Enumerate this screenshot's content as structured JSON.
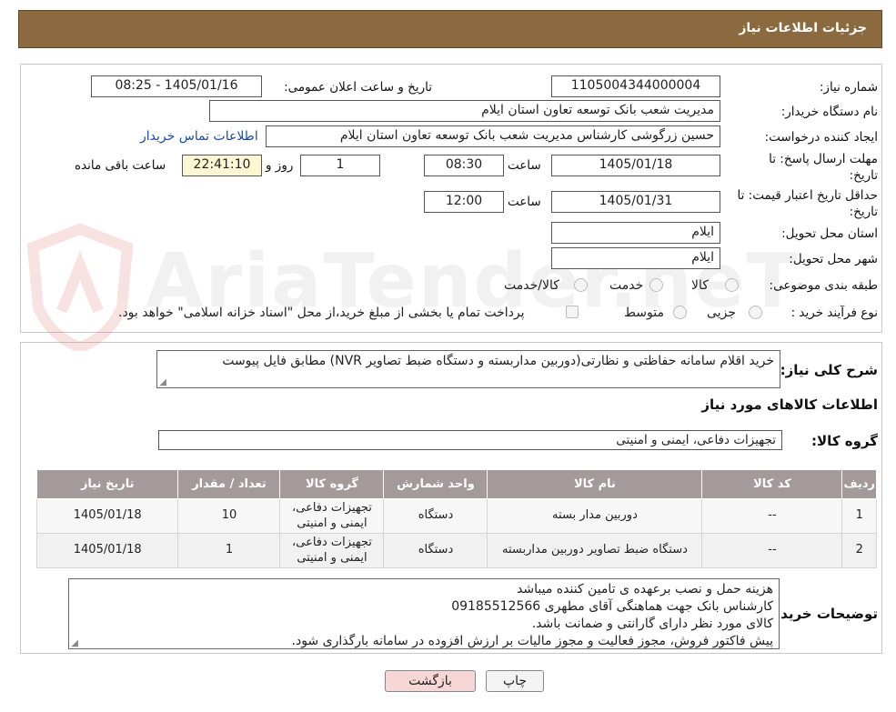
{
  "header": {
    "title": "جزئیات اطلاعات نیاز"
  },
  "watermark": {
    "text": "AriaTender.neT"
  },
  "form": {
    "need_number_label": "شماره نیاز:",
    "need_number": "1105004344000004",
    "announce_label": "تاریخ و ساعت اعلان عمومی:",
    "announce_value": "1405/01/16 - 08:25",
    "buyer_label": "نام دستگاه خریدار:",
    "buyer_value": "مدیریت شعب بانک توسعه تعاون استان ایلام",
    "creator_label": "ایجاد کننده درخواست:",
    "creator_value": "حسین زرگوشی کارشناس مدیریت شعب بانک توسعه تعاون استان ایلام",
    "contact_link": "اطلاعات تماس خریدار",
    "reply_deadline_label": "مهلت ارسال پاسخ: تا تاریخ:",
    "reply_date": "1405/01/18",
    "time_label": "ساعت",
    "reply_time": "08:30",
    "days_value": "1",
    "days_label": "روز و",
    "remaining_time": "22:41:10",
    "remaining_label": "ساعت باقی مانده",
    "validity_label": "حداقل تاریخ اعتبار قیمت: تا تاریخ:",
    "validity_date": "1405/01/31",
    "validity_time": "12:00",
    "province_label": "استان محل تحویل:",
    "province_value": "ایلام",
    "city_label": "شهر محل تحویل:",
    "city_value": "ایلام",
    "category_label": "طبقه بندی موضوعی:",
    "category_options": [
      "کالا",
      "خدمت",
      "کالا/خدمت"
    ],
    "process_label": "نوع فرآیند خرید :",
    "process_options": [
      "جزیی",
      "متوسط"
    ],
    "payment_note": "پرداخت تمام یا بخشی از مبلغ خرید،از محل \"اسناد خزانه اسلامی\" خواهد بود."
  },
  "details": {
    "summary_label": "شرح کلی نیاز:",
    "summary_value": "خرید اقلام سامانه حفاظتی و نظارتی(دوربین مداربسته و دستگاه ضبط تصاویر NVR) مطابق فایل پیوست",
    "goods_info_title": "اطلاعات کالاهای مورد نیاز",
    "goods_group_label": "گروه کالا:",
    "goods_group_value": "تجهیزات دفاعی، ایمنی و امنیتی",
    "table": {
      "headers": [
        "ردیف",
        "کد کالا",
        "نام کالا",
        "واحد شمارش",
        "گروه کالا",
        "تعداد / مقدار",
        "تاریخ نیاز"
      ],
      "rows": [
        [
          "1",
          "--",
          "دوربین مدار بسته",
          "دستگاه",
          "تجهیزات دفاعی، ایمنی و امنیتی",
          "10",
          "1405/01/18"
        ],
        [
          "2",
          "--",
          "دستگاه ضبط تصاویر دوربین مداربسته",
          "دستگاه",
          "تجهیزات دفاعی، ایمنی و امنیتی",
          "1",
          "1405/01/18"
        ]
      ]
    },
    "buyer_notes_label": "توضیحات خریدار:",
    "buyer_notes_lines": [
      "هزینه حمل و نصب برعهده ی تامین کننده میباشد",
      "کارشناس بانک جهت هماهنگی آقای مطهری 09185512566",
      "کالای مورد نظر دارای گارانتی و ضمانت باشد.",
      "پیش فاکتور فروش، مجوز فعالیت و مجوز مالیات بر ارزش افزوده در سامانه بارگذاری شود."
    ]
  },
  "buttons": {
    "print": "چاپ",
    "back": "بازگشت"
  },
  "colors": {
    "header_bg": "#8b6a3f",
    "table_header_bg": "#a59a9a",
    "link": "#1c4ca6",
    "back_btn_bg": "#f7d6d6"
  }
}
